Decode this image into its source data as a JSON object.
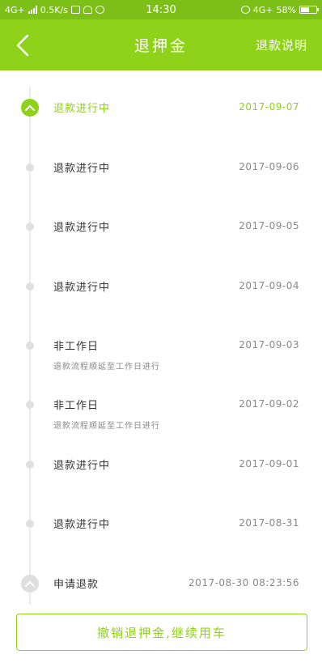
{
  "status_bar": {
    "network": "4G+",
    "speed": "0.5K/s",
    "time": "14:30",
    "right_network": "4G+",
    "battery": "58%",
    "battery_level": 0.58
  },
  "nav": {
    "back_icon": "chevron-left-icon",
    "title": "退押金",
    "right_link": "退款说明"
  },
  "colors": {
    "brand_green": "#8fd21a",
    "status_green": "#7cbf16"
  },
  "timeline": [
    {
      "title": "退款进行中",
      "date": "2017-09-07",
      "active": true
    },
    {
      "title": "退款进行中",
      "date": "2017-09-06"
    },
    {
      "title": "退款进行中",
      "date": "2017-09-05"
    },
    {
      "title": "退款进行中",
      "date": "2017-09-04"
    },
    {
      "title": "非工作日",
      "date": "2017-09-03",
      "sub": "退款流程顺延至工作日进行"
    },
    {
      "title": "非工作日",
      "date": "2017-09-02",
      "sub": "退款流程顺延至工作日进行"
    },
    {
      "title": "退款进行中",
      "date": "2017-09-01"
    },
    {
      "title": "退款进行中",
      "date": "2017-08-31"
    },
    {
      "title": "申请退款",
      "date": "2017-08-30 08:23:56"
    }
  ],
  "bottom_button": "撤销退押金,继续用车"
}
